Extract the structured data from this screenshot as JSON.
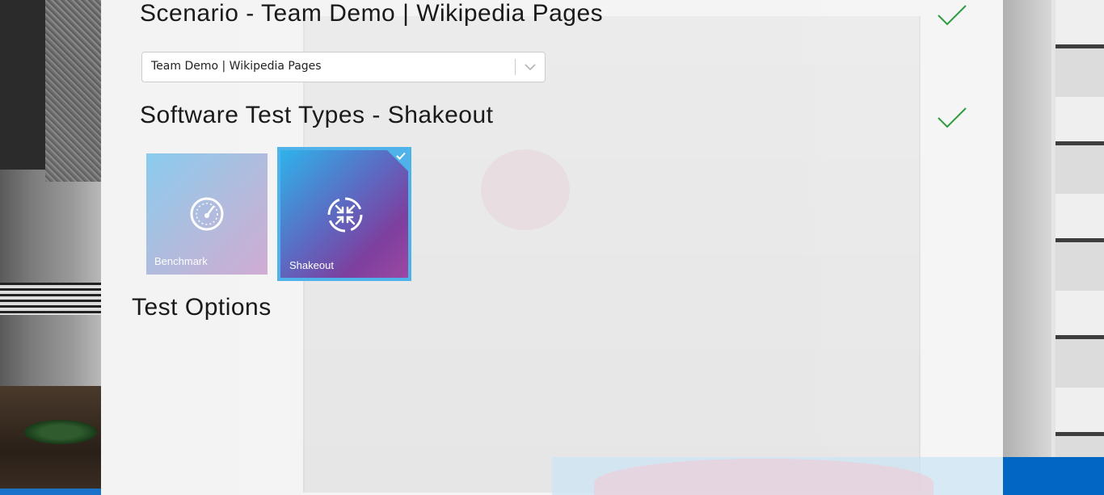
{
  "scenario": {
    "title": "Scenario - Team Demo | Wikipedia Pages",
    "selected_value": "Team Demo | Wikipedia Pages",
    "complete_icon": "checkmark-icon",
    "dropdown_icon": "chevron-down-icon"
  },
  "test_types": {
    "title": "Software Test Types - Shakeout",
    "complete_icon": "checkmark-icon",
    "tiles": [
      {
        "label": "Benchmark",
        "icon": "speedometer-icon",
        "selected": false
      },
      {
        "label": "Shakeout",
        "icon": "arrows-inward-icon",
        "selected": true
      }
    ]
  },
  "test_options": {
    "title": "Test Options"
  },
  "colors": {
    "check_green": "#2e9b3f",
    "selected_border": "#4fb3ea",
    "brand_blue": "#0067c5"
  }
}
